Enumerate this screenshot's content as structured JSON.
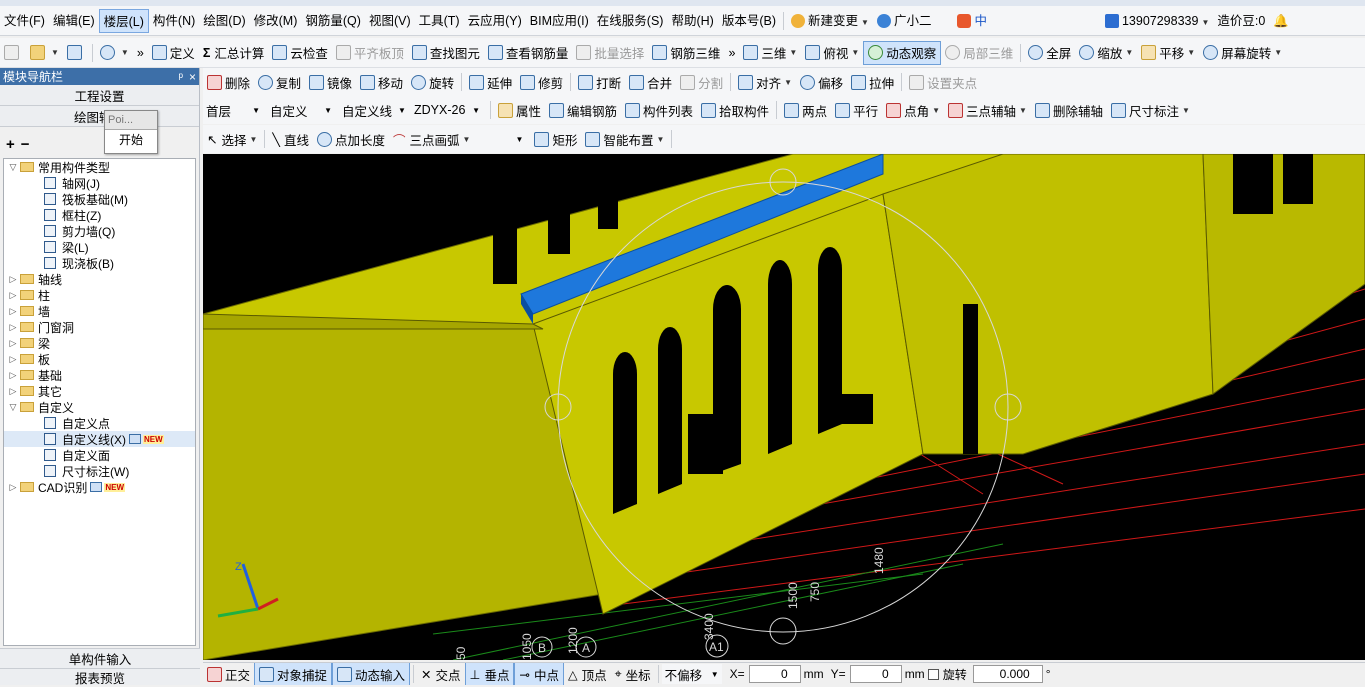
{
  "menubar": {
    "items": [
      "文件(F)",
      "编辑(E)",
      "楼层(L)",
      "构件(N)",
      "绘图(D)",
      "修改(M)",
      "钢筋量(Q)",
      "视图(V)",
      "工具(T)",
      "云应用(Y)",
      "BIM应用(I)",
      "在线服务(S)",
      "帮助(H)",
      "版本号(B)"
    ],
    "active": "楼层(L)",
    "new_change": "新建变更",
    "assistant": "广小二",
    "ime_label": "中",
    "phone": "13907298339",
    "price_bean": "造价豆:0"
  },
  "toolbar1": {
    "items": [
      "定义",
      "汇总计算",
      "云检查",
      "平齐板顶",
      "查找图元",
      "查看钢筋量",
      "批量选择",
      "钢筋三维",
      "三维",
      "俯视",
      "动态观察",
      "局部三维",
      "全屏",
      "缩放",
      "平移",
      "屏幕旋转"
    ],
    "pressed": "动态观察",
    "disabled": [
      "平齐板顶",
      "批量选择",
      "局部三维"
    ],
    "sigma": "Σ"
  },
  "panel": {
    "title": "模块导航栏",
    "pin": "ᵖ",
    "close": "×",
    "btn_project_settings": "工程设置",
    "btn_draw_input": "绘图输",
    "popup_poi": "Poi...",
    "popup_start": "开始",
    "expand_all": "+",
    "collapse_all": "−",
    "tree": [
      {
        "level": 0,
        "exp": "▽",
        "type": "folder",
        "label": "常用构件类型"
      },
      {
        "level": 1,
        "type": "leaf",
        "label": "轴网(J)"
      },
      {
        "level": 1,
        "type": "leaf",
        "label": "筏板基础(M)"
      },
      {
        "level": 1,
        "type": "leaf",
        "label": "框柱(Z)"
      },
      {
        "level": 1,
        "type": "leaf",
        "label": "剪力墙(Q)"
      },
      {
        "level": 1,
        "type": "leaf",
        "label": "梁(L)"
      },
      {
        "level": 1,
        "type": "leaf",
        "label": "现浇板(B)"
      },
      {
        "level": 0,
        "exp": "▷",
        "type": "folder",
        "label": "轴线"
      },
      {
        "level": 0,
        "exp": "▷",
        "type": "folder",
        "label": "柱"
      },
      {
        "level": 0,
        "exp": "▷",
        "type": "folder",
        "label": "墙"
      },
      {
        "level": 0,
        "exp": "▷",
        "type": "folder",
        "label": "门窗洞"
      },
      {
        "level": 0,
        "exp": "▷",
        "type": "folder",
        "label": "梁"
      },
      {
        "level": 0,
        "exp": "▷",
        "type": "folder",
        "label": "板"
      },
      {
        "level": 0,
        "exp": "▷",
        "type": "folder",
        "label": "基础"
      },
      {
        "level": 0,
        "exp": "▷",
        "type": "folder",
        "label": "其它"
      },
      {
        "level": 0,
        "exp": "▽",
        "type": "folder",
        "label": "自定义"
      },
      {
        "level": 1,
        "type": "leaf",
        "label": "自定义点"
      },
      {
        "level": 1,
        "type": "leaf",
        "label": "自定义线(X)",
        "badge": "NEW",
        "selected": true
      },
      {
        "level": 1,
        "type": "leaf",
        "label": "自定义面"
      },
      {
        "level": 1,
        "type": "leaf",
        "label": "尺寸标注(W)"
      },
      {
        "level": 0,
        "exp": "▷",
        "type": "folder",
        "label": "CAD识别",
        "badge": "NEW"
      }
    ],
    "bottom1": "单构件输入",
    "bottom2": "报表预览"
  },
  "toolbar2": {
    "items": [
      "删除",
      "复制",
      "镜像",
      "移动",
      "旋转",
      "延伸",
      "修剪",
      "打断",
      "合并",
      "分割",
      "对齐",
      "偏移",
      "拉伸",
      "设置夹点"
    ],
    "disabled": [
      "分割",
      "设置夹点"
    ]
  },
  "toolbar3": {
    "floor": "首层",
    "type": "自定义",
    "subtype": "自定义线",
    "code": "ZDYX-26",
    "items": [
      "属性",
      "编辑钢筋",
      "构件列表",
      "拾取构件",
      "两点",
      "平行",
      "点角",
      "三点辅轴",
      "删除辅轴",
      "尺寸标注"
    ]
  },
  "toolbar4": {
    "items": [
      "选择",
      "直线",
      "点加长度",
      "三点画弧",
      "矩形",
      "智能布置"
    ],
    "blank_combo": ""
  },
  "viewport": {
    "dims": [
      "1480",
      "1500",
      "750",
      "3400",
      "1200",
      "1050",
      "50"
    ],
    "axis_labels": [
      "A1",
      "A",
      "B"
    ]
  },
  "statusbar": {
    "ortho": "正交",
    "snap": "对象捕捉",
    "dynamic_input": "动态输入",
    "snap_modes": [
      "交点",
      "垂点",
      "中点",
      "顶点",
      "坐标"
    ],
    "pressed_modes": [
      "垂点",
      "中点"
    ],
    "offset_mode": "不偏移",
    "x_label": "X=",
    "x_value": "0",
    "y_label": "Y=",
    "y_value": "0",
    "unit": "mm",
    "rotate_label": "旋转",
    "rotate_value": "0.000",
    "degree": "°"
  },
  "colors": {
    "model_yellow": "#c8c800",
    "beam_blue": "#1e78dc",
    "accent_blue": "#3d6fa8",
    "rebar_red": "#d01818",
    "rebar_green": "#1a8a1a"
  }
}
